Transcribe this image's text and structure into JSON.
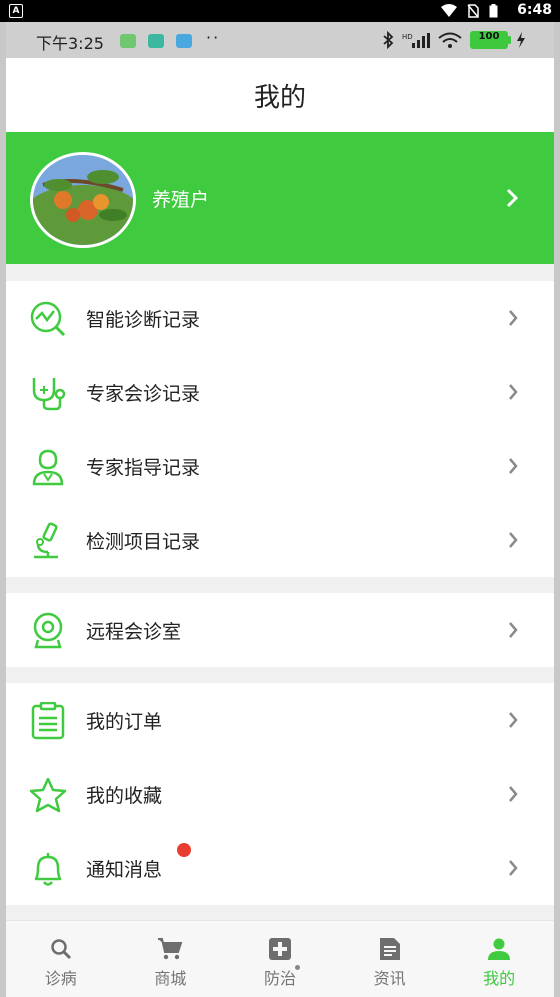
{
  "system": {
    "time": "6:48",
    "launcher_badge": "A"
  },
  "inner_status": {
    "time": "下午3:25",
    "dots": "··",
    "battery": "100"
  },
  "page_title": "我的",
  "profile": {
    "name": "养殖户"
  },
  "menu_groups": [
    [
      {
        "label": "智能诊断记录",
        "icon": "diagnosis-chart-icon"
      },
      {
        "label": "专家会诊记录",
        "icon": "stethoscope-icon"
      },
      {
        "label": "专家指导记录",
        "icon": "doctor-icon"
      },
      {
        "label": "检测项目记录",
        "icon": "microscope-icon"
      }
    ],
    [
      {
        "label": "远程会诊室",
        "icon": "webcam-icon"
      }
    ],
    [
      {
        "label": "我的订单",
        "icon": "clipboard-icon"
      },
      {
        "label": "我的收藏",
        "icon": "star-icon"
      },
      {
        "label": "通知消息",
        "icon": "bell-icon"
      }
    ]
  ],
  "bottom_nav": [
    {
      "label": "诊病",
      "icon": "search-icon",
      "active": false
    },
    {
      "label": "商城",
      "icon": "cart-icon",
      "active": false
    },
    {
      "label": "防治",
      "icon": "medical-plus-icon",
      "active": false
    },
    {
      "label": "资讯",
      "icon": "article-icon",
      "active": false
    },
    {
      "label": "我的",
      "icon": "person-icon",
      "active": true
    }
  ],
  "colors": {
    "accent": "#3fca3f",
    "notify": "#e93d30",
    "chevron": "#8a8a8a"
  }
}
